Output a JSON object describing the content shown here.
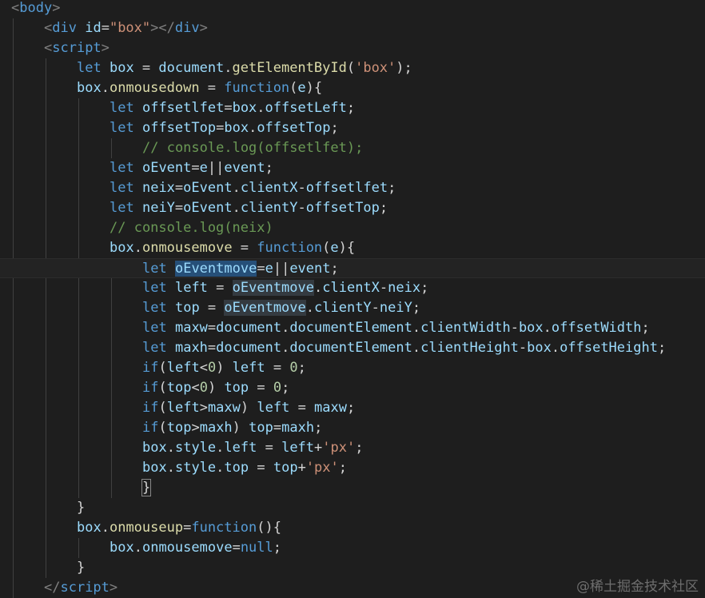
{
  "editor": {
    "theme_colors": {
      "background": "#1e1e1e",
      "keyword": "#569cd6",
      "variable": "#9cdcfe",
      "function": "#dcdcaa",
      "string": "#ce9178",
      "number": "#b5cea8",
      "comment": "#6a9955",
      "plain": "#d4d4d4",
      "tag_bracket": "#808080",
      "selection": "#264f78"
    },
    "current_line_index": 13,
    "lines": [
      {
        "indent": 0,
        "tokens": [
          [
            "tg",
            "<"
          ],
          [
            "tn",
            "body"
          ],
          [
            "tg",
            ">"
          ]
        ]
      },
      {
        "indent": 1,
        "tokens": [
          [
            "tg",
            "<"
          ],
          [
            "tn",
            "div"
          ],
          [
            "o",
            " "
          ],
          [
            "at",
            "id"
          ],
          [
            "o",
            "="
          ],
          [
            "s",
            "\"box\""
          ],
          [
            "tg",
            "></"
          ],
          [
            "tn",
            "div"
          ],
          [
            "tg",
            ">"
          ]
        ]
      },
      {
        "indent": 1,
        "tokens": [
          [
            "tg",
            "<"
          ],
          [
            "tn",
            "script"
          ],
          [
            "tg",
            ">"
          ]
        ]
      },
      {
        "indent": 2,
        "tokens": [
          [
            "k",
            "let"
          ],
          [
            "o",
            " "
          ],
          [
            "v",
            "box"
          ],
          [
            "o",
            " = "
          ],
          [
            "v",
            "document"
          ],
          [
            "o",
            "."
          ],
          [
            "f",
            "getElementById"
          ],
          [
            "o",
            "("
          ],
          [
            "s",
            "'box'"
          ],
          [
            "o",
            ");"
          ]
        ]
      },
      {
        "indent": 2,
        "tokens": [
          [
            "v",
            "box"
          ],
          [
            "o",
            "."
          ],
          [
            "f",
            "onmousedown"
          ],
          [
            "o",
            " = "
          ],
          [
            "k",
            "function"
          ],
          [
            "o",
            "("
          ],
          [
            "v",
            "e"
          ],
          [
            "o",
            "){"
          ]
        ]
      },
      {
        "indent": 3,
        "tokens": [
          [
            "k",
            "let"
          ],
          [
            "o",
            " "
          ],
          [
            "v",
            "offsetlfet"
          ],
          [
            "o",
            "="
          ],
          [
            "v",
            "box"
          ],
          [
            "o",
            "."
          ],
          [
            "p",
            "offsetLeft"
          ],
          [
            "o",
            ";"
          ]
        ]
      },
      {
        "indent": 3,
        "tokens": [
          [
            "k",
            "let"
          ],
          [
            "o",
            " "
          ],
          [
            "v",
            "offsetTop"
          ],
          [
            "o",
            "="
          ],
          [
            "v",
            "box"
          ],
          [
            "o",
            "."
          ],
          [
            "p",
            "offsetTop"
          ],
          [
            "o",
            ";"
          ]
        ]
      },
      {
        "indent": 4,
        "tokens": [
          [
            "c",
            "// console.log(offsetlfet);"
          ]
        ]
      },
      {
        "indent": 3,
        "tokens": [
          [
            "k",
            "let"
          ],
          [
            "o",
            " "
          ],
          [
            "v",
            "oEvent"
          ],
          [
            "o",
            "="
          ],
          [
            "v",
            "e"
          ],
          [
            "o",
            "||"
          ],
          [
            "v",
            "event"
          ],
          [
            "o",
            ";"
          ]
        ]
      },
      {
        "indent": 3,
        "tokens": [
          [
            "k",
            "let"
          ],
          [
            "o",
            " "
          ],
          [
            "v",
            "neix"
          ],
          [
            "o",
            "="
          ],
          [
            "v",
            "oEvent"
          ],
          [
            "o",
            "."
          ],
          [
            "v",
            "clientX"
          ],
          [
            "o",
            "-"
          ],
          [
            "v",
            "offsetlfet"
          ],
          [
            "o",
            ";"
          ]
        ]
      },
      {
        "indent": 3,
        "tokens": [
          [
            "k",
            "let"
          ],
          [
            "o",
            " "
          ],
          [
            "v",
            "neiY"
          ],
          [
            "o",
            "="
          ],
          [
            "v",
            "oEvent"
          ],
          [
            "o",
            "."
          ],
          [
            "v",
            "clientY"
          ],
          [
            "o",
            "-"
          ],
          [
            "v",
            "offsetTop"
          ],
          [
            "o",
            ";"
          ]
        ]
      },
      {
        "indent": 3,
        "tokens": [
          [
            "c",
            "// console.log(neix)"
          ]
        ]
      },
      {
        "indent": 3,
        "tokens": [
          [
            "v",
            "box"
          ],
          [
            "o",
            "."
          ],
          [
            "f",
            "onmousemove"
          ],
          [
            "o",
            " = "
          ],
          [
            "k",
            "function"
          ],
          [
            "o",
            "("
          ],
          [
            "v",
            "e"
          ],
          [
            "o",
            "){"
          ]
        ]
      },
      {
        "indent": 4,
        "tokens": [
          [
            "k",
            "let"
          ],
          [
            "o",
            " "
          ],
          [
            "v hl",
            "oEventmove"
          ],
          [
            "o",
            "="
          ],
          [
            "v",
            "e"
          ],
          [
            "o",
            "||"
          ],
          [
            "v",
            "event"
          ],
          [
            "o",
            ";"
          ]
        ]
      },
      {
        "indent": 4,
        "tokens": [
          [
            "k",
            "let"
          ],
          [
            "o",
            " "
          ],
          [
            "v",
            "left"
          ],
          [
            "o",
            " = "
          ],
          [
            "v hl2",
            "oEventmove"
          ],
          [
            "o",
            "."
          ],
          [
            "v",
            "clientX"
          ],
          [
            "o",
            "-"
          ],
          [
            "v",
            "neix"
          ],
          [
            "o",
            ";"
          ]
        ]
      },
      {
        "indent": 4,
        "tokens": [
          [
            "k",
            "let"
          ],
          [
            "o",
            " "
          ],
          [
            "v",
            "top"
          ],
          [
            "o",
            " = "
          ],
          [
            "v hl2",
            "oEventmove"
          ],
          [
            "o",
            "."
          ],
          [
            "v",
            "clientY"
          ],
          [
            "o",
            "-"
          ],
          [
            "v",
            "neiY"
          ],
          [
            "o",
            ";"
          ]
        ]
      },
      {
        "indent": 4,
        "tokens": [
          [
            "k",
            "let"
          ],
          [
            "o",
            " "
          ],
          [
            "v",
            "maxw"
          ],
          [
            "o",
            "="
          ],
          [
            "v",
            "document"
          ],
          [
            "o",
            "."
          ],
          [
            "p",
            "documentElement"
          ],
          [
            "o",
            "."
          ],
          [
            "p",
            "clientWidth"
          ],
          [
            "o",
            "-"
          ],
          [
            "v",
            "box"
          ],
          [
            "o",
            "."
          ],
          [
            "p",
            "offsetWidth"
          ],
          [
            "o",
            ";"
          ]
        ]
      },
      {
        "indent": 4,
        "tokens": [
          [
            "k",
            "let"
          ],
          [
            "o",
            " "
          ],
          [
            "v",
            "maxh"
          ],
          [
            "o",
            "="
          ],
          [
            "v",
            "document"
          ],
          [
            "o",
            "."
          ],
          [
            "p",
            "documentElement"
          ],
          [
            "o",
            "."
          ],
          [
            "p",
            "clientHeight"
          ],
          [
            "o",
            "-"
          ],
          [
            "v",
            "box"
          ],
          [
            "o",
            "."
          ],
          [
            "p",
            "offsetHeight"
          ],
          [
            "o",
            ";"
          ]
        ]
      },
      {
        "indent": 4,
        "tokens": [
          [
            "k",
            "if"
          ],
          [
            "o",
            "("
          ],
          [
            "v",
            "left"
          ],
          [
            "o",
            "<"
          ],
          [
            "n",
            "0"
          ],
          [
            "o",
            ") "
          ],
          [
            "v",
            "left"
          ],
          [
            "o",
            " = "
          ],
          [
            "n",
            "0"
          ],
          [
            "o",
            ";"
          ]
        ]
      },
      {
        "indent": 4,
        "tokens": [
          [
            "k",
            "if"
          ],
          [
            "o",
            "("
          ],
          [
            "v",
            "top"
          ],
          [
            "o",
            "<"
          ],
          [
            "n",
            "0"
          ],
          [
            "o",
            ") "
          ],
          [
            "v",
            "top"
          ],
          [
            "o",
            " = "
          ],
          [
            "n",
            "0"
          ],
          [
            "o",
            ";"
          ]
        ]
      },
      {
        "indent": 4,
        "tokens": [
          [
            "k",
            "if"
          ],
          [
            "o",
            "("
          ],
          [
            "v",
            "left"
          ],
          [
            "o",
            ">"
          ],
          [
            "v",
            "maxw"
          ],
          [
            "o",
            ") "
          ],
          [
            "v",
            "left"
          ],
          [
            "o",
            " = "
          ],
          [
            "v",
            "maxw"
          ],
          [
            "o",
            ";"
          ]
        ]
      },
      {
        "indent": 4,
        "tokens": [
          [
            "k",
            "if"
          ],
          [
            "o",
            "("
          ],
          [
            "v",
            "top"
          ],
          [
            "o",
            ">"
          ],
          [
            "v",
            "maxh"
          ],
          [
            "o",
            ") "
          ],
          [
            "v",
            "top"
          ],
          [
            "o",
            "="
          ],
          [
            "v",
            "maxh"
          ],
          [
            "o",
            ";"
          ]
        ]
      },
      {
        "indent": 4,
        "tokens": [
          [
            "v",
            "box"
          ],
          [
            "o",
            "."
          ],
          [
            "v",
            "style"
          ],
          [
            "o",
            "."
          ],
          [
            "v",
            "left"
          ],
          [
            "o",
            " = "
          ],
          [
            "v",
            "left"
          ],
          [
            "o",
            "+"
          ],
          [
            "s",
            "'px'"
          ],
          [
            "o",
            ";"
          ]
        ]
      },
      {
        "indent": 4,
        "tokens": [
          [
            "v",
            "box"
          ],
          [
            "o",
            "."
          ],
          [
            "v",
            "style"
          ],
          [
            "o",
            "."
          ],
          [
            "v",
            "top"
          ],
          [
            "o",
            " = "
          ],
          [
            "v",
            "top"
          ],
          [
            "o",
            "+"
          ],
          [
            "s",
            "'px'"
          ],
          [
            "o",
            ";"
          ]
        ]
      },
      {
        "indent": 4,
        "tokens": [
          [
            "o bm",
            "}"
          ]
        ]
      },
      {
        "indent": 2,
        "tokens": [
          [
            "o",
            "}"
          ]
        ]
      },
      {
        "indent": 2,
        "tokens": [
          [
            "v",
            "box"
          ],
          [
            "o",
            "."
          ],
          [
            "f",
            "onmouseup"
          ],
          [
            "o",
            "="
          ],
          [
            "k",
            "function"
          ],
          [
            "o",
            "(){"
          ]
        ]
      },
      {
        "indent": 3,
        "tokens": [
          [
            "v",
            "box"
          ],
          [
            "o",
            "."
          ],
          [
            "v",
            "onmousemove"
          ],
          [
            "o",
            "="
          ],
          [
            "k",
            "null"
          ],
          [
            "o",
            ";"
          ]
        ]
      },
      {
        "indent": 2,
        "tokens": [
          [
            "o",
            "}"
          ]
        ]
      },
      {
        "indent": 1,
        "tokens": [
          [
            "tg",
            "</"
          ],
          [
            "tn",
            "script"
          ],
          [
            "tg",
            ">"
          ]
        ]
      }
    ]
  },
  "watermark": "@稀土掘金技术社区"
}
